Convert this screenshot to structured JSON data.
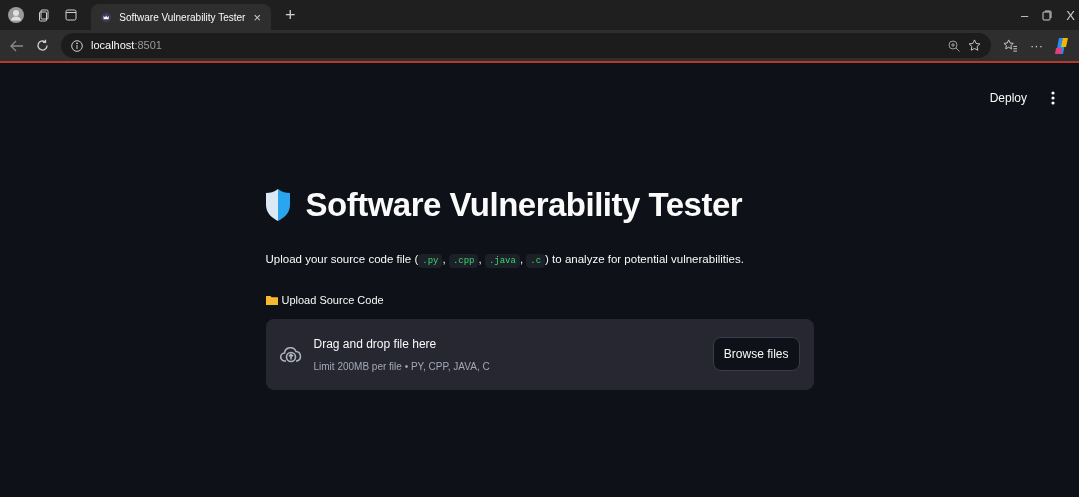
{
  "browser": {
    "tab_title": "Software Vulnerability Tester",
    "tab_close": "×",
    "new_tab": "+",
    "url_host": "localhost",
    "url_port": ":8501",
    "more": "···",
    "window_controls": [
      "–",
      "X"
    ]
  },
  "header": {
    "deploy": "Deploy"
  },
  "title": "Software Vulnerability Tester",
  "description": [
    {
      "kind": "text",
      "text": "Upload your source code file ("
    },
    {
      "kind": "code",
      "text": ".py"
    },
    {
      "kind": "text",
      "text": ", "
    },
    {
      "kind": "code",
      "text": ".cpp"
    },
    {
      "kind": "text",
      "text": ", "
    },
    {
      "kind": "code",
      "text": ".java"
    },
    {
      "kind": "text",
      "text": ", "
    },
    {
      "kind": "code",
      "text": ".c"
    },
    {
      "kind": "text",
      "text": ") to analyze for potential vulnerabilities."
    }
  ],
  "uploader": {
    "label": "Upload Source Code",
    "drop_text": "Drag and drop file here",
    "limit_text": "Limit 200MB per file • PY, CPP, JAVA, C",
    "button": "Browse files"
  }
}
